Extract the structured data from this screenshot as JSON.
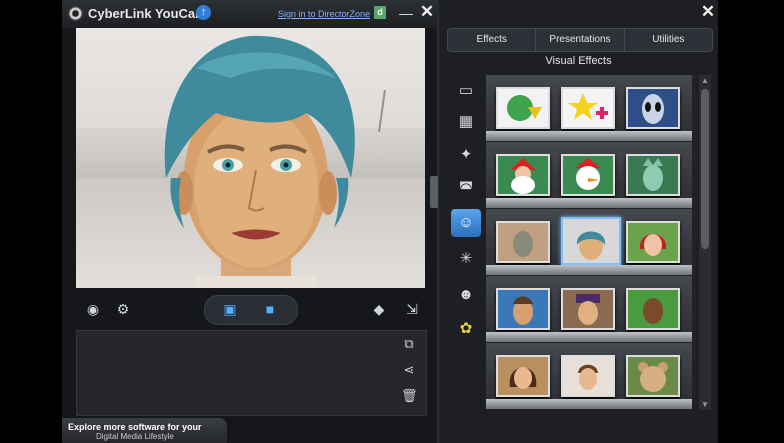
{
  "titlebar": {
    "app_title": "CyberLink YouCam",
    "signin_link": "Sign in to DirectorZone",
    "dz_glyph": "d",
    "update_icon": "up-arrow-icon",
    "minimize_glyph": "—",
    "close_glyph": "✕"
  },
  "controls": {
    "eye_icon": "eye-icon",
    "settings_icon": "gear-icon",
    "capture_icon": "camera-icon",
    "record_icon": "video-camera-icon",
    "eraser_icon": "eraser-icon",
    "resize_icon": "resize-icon"
  },
  "gallery_side": [
    "import-icon",
    "share-icon",
    "trash-icon"
  ],
  "promo": {
    "line1": "Explore more software for your",
    "line2": "Digital Media Lifestyle"
  },
  "right_panel": {
    "close_glyph": "✕",
    "tabs": [
      "Effects",
      "Presentations",
      "Utilities"
    ],
    "section_title": "Visual Effects",
    "sidebar_icons": [
      "frame-icon",
      "scene-icon",
      "magic-wand-icon",
      "mask-icon",
      "avatar-icon",
      "particle-icon",
      "emotion-icon",
      "gadget-icon"
    ],
    "active_sidebar_index": 4,
    "shelves": [
      [
        "globe-download",
        "star-add",
        "alien-face"
      ],
      [
        "santa-face",
        "snowman-face",
        "liberty-face"
      ],
      [
        "statue-face",
        "avatar-teal-hair",
        "redhead-face"
      ],
      [
        "man-face",
        "hat-man-face",
        "dark-man-face"
      ],
      [
        "woman-face",
        "boy-face",
        "bear-face"
      ]
    ],
    "selected_thumb": "avatar-teal-hair"
  }
}
